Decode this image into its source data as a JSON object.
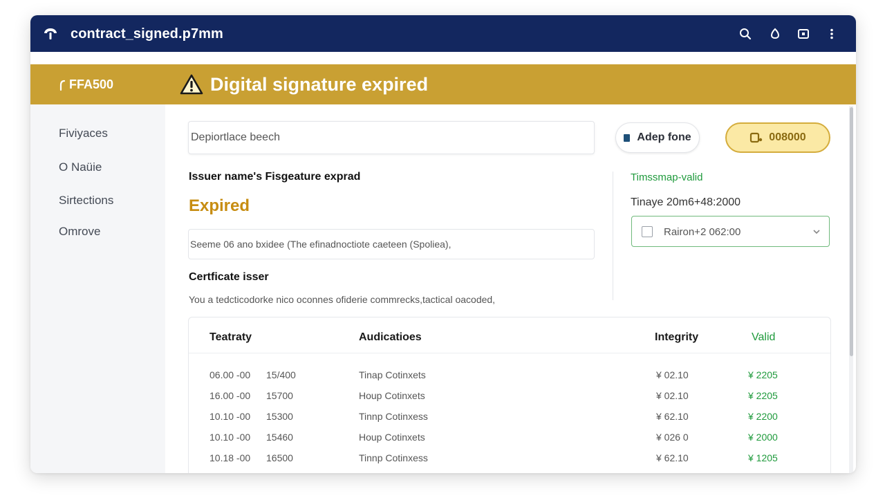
{
  "window": {
    "title": "contract_signed.p7mm"
  },
  "banner": {
    "code": "FFA500",
    "message": "Digital signature expired"
  },
  "sidebar": {
    "items": [
      {
        "label": "Fiviyaces"
      },
      {
        "label": "O Naüie"
      },
      {
        "label": "Sirtections"
      },
      {
        "label": "Omrove"
      }
    ]
  },
  "search": {
    "value": "Depiortlace beech"
  },
  "buttons": {
    "adep_label": "Adep fone",
    "gold_label": "008000"
  },
  "details": {
    "issuer_heading": "Issuer name's Fisgeature exprad",
    "status": "Expired",
    "note": "Seeme 06 ano bxidee (The efinadnoctiote caeteen (Spoliea),",
    "certificate_heading": "Certficate isser",
    "description": "You a tedcticodorke nico oconnes ofiderie commrecks,tactical oacoded,"
  },
  "timestamp": {
    "status": "Timssmap-valid",
    "time": "Tinaye 20m6+48:2000",
    "selected": "Rairon+2 062:00"
  },
  "table": {
    "columns": [
      "Teatraty",
      "Audicatioes",
      "Integrity",
      "Valid"
    ],
    "rows": [
      {
        "date": "06.00 -00",
        "num": "15/400",
        "name": "Tinap Cotinxets",
        "integrity": "¥ 02.10",
        "valid": "¥ 2205"
      },
      {
        "date": "16.00 -00",
        "num": "15700",
        "name": "Houp Cotinxets",
        "integrity": "¥ 02.10",
        "valid": "¥ 2205"
      },
      {
        "date": "10.10 -00",
        "num": "15300",
        "name": "Tinnp Cotinxess",
        "integrity": "¥ 62.10",
        "valid": "¥ 2200"
      },
      {
        "date": "10.10 -00",
        "num": "15460",
        "name": "Houp Cotinxets",
        "integrity": "¥ 026 0",
        "valid": "¥ 2000"
      },
      {
        "date": "10.18 -00",
        "num": "16500",
        "name": "Tinnp Cotinxess",
        "integrity": "¥ 62.10",
        "valid": "¥ 1205"
      }
    ]
  },
  "colors": {
    "titlebar": "#13275f",
    "banner": "#c9a033",
    "expired": "#c78d12",
    "valid_green": "#1f9a3c"
  }
}
